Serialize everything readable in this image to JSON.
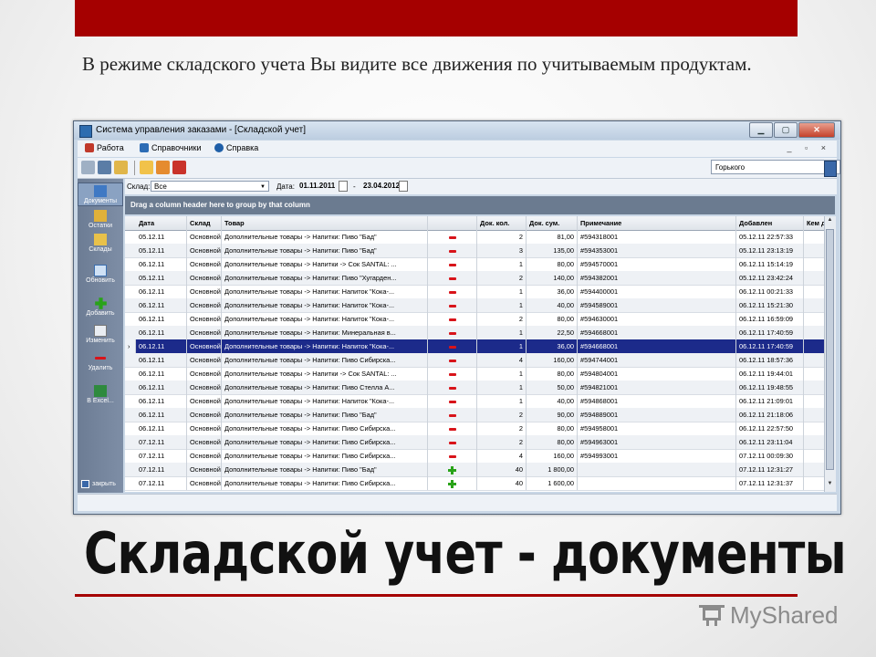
{
  "slide": {
    "subtitle": "В режиме складского учета Вы видите все движения по учитываемым продуктам.",
    "title": "Складской учет - документы",
    "brand": "MyShared"
  },
  "app": {
    "window_title": "Система управления заказами - [Складской учет]",
    "window_buttons": [
      "▁",
      "▢",
      "✕"
    ],
    "menu": [
      {
        "label": "Работа",
        "icon": "work-icon"
      },
      {
        "label": "Справочники",
        "icon": "references-icon"
      },
      {
        "label": "Справка",
        "icon": "help-icon"
      }
    ],
    "mdi_controls": "_ ▫ ×",
    "style_select": "Горького",
    "filter": {
      "warehouse_label": "Склад:",
      "warehouse_value": "Все",
      "date_label": "Дата:",
      "date_from": "01.11.2011",
      "date_sep": "-",
      "date_to": "23.04.2012"
    },
    "group_hint": "Drag a column header here to group by that column",
    "sidebar": [
      {
        "label": "Документы",
        "icon": "documents-icon",
        "active": true
      },
      {
        "label": "Остатки",
        "icon": "balance-icon"
      },
      {
        "label": "Склады",
        "icon": "warehouses-icon"
      },
      {
        "label": "Обновить",
        "icon": "refresh-icon"
      },
      {
        "label": "Добавить",
        "icon": "add-icon"
      },
      {
        "label": "Изменить",
        "icon": "edit-icon"
      },
      {
        "label": "Удалить",
        "icon": "delete-icon"
      },
      {
        "label": "В Excel...",
        "icon": "excel-icon"
      },
      {
        "label": "закрыть",
        "icon": "close-panel-icon"
      }
    ],
    "columns": [
      "Дата",
      "Склад",
      "Товар",
      "",
      "Док. кол.",
      "Док. сум.",
      "Примечание",
      "Добавлен",
      "Кем добавлен"
    ],
    "rows": [
      {
        "date": "05.12.11",
        "store": "Основной",
        "item": "Дополнительные товары -> Напитки: Пиво \"Бад\"",
        "op": "minus",
        "qty": "2",
        "sum": "81,00",
        "note": "#594318001",
        "added": "05.12.11 22:57:33",
        "by": ""
      },
      {
        "date": "05.12.11",
        "store": "Основной",
        "item": "Дополнительные товары -> Напитки: Пиво \"Бад\"",
        "op": "minus",
        "qty": "3",
        "sum": "135,00",
        "note": "#594353001",
        "added": "05.12.11 23:13:19",
        "by": ""
      },
      {
        "date": "06.12.11",
        "store": "Основной",
        "item": "Дополнительные товары -> Напитки -> Сок SANTAL: ...",
        "op": "minus",
        "qty": "1",
        "sum": "80,00",
        "note": "#594570001",
        "added": "06.12.11 15:14:19",
        "by": ""
      },
      {
        "date": "05.12.11",
        "store": "Основной",
        "item": "Дополнительные товары -> Напитки: Пиво \"Хугарден...",
        "op": "minus",
        "qty": "2",
        "sum": "140,00",
        "note": "#594382001",
        "added": "05.12.11 23:42:24",
        "by": ""
      },
      {
        "date": "06.12.11",
        "store": "Основной",
        "item": "Дополнительные товары -> Напитки: Напиток \"Кока-...",
        "op": "minus",
        "qty": "1",
        "sum": "36,00",
        "note": "#594400001",
        "added": "06.12.11 00:21:33",
        "by": ""
      },
      {
        "date": "06.12.11",
        "store": "Основной",
        "item": "Дополнительные товары -> Напитки: Напиток \"Кока-...",
        "op": "minus",
        "qty": "1",
        "sum": "40,00",
        "note": "#594589001",
        "added": "06.12.11 15:21:30",
        "by": ""
      },
      {
        "date": "06.12.11",
        "store": "Основной",
        "item": "Дополнительные товары -> Напитки: Напиток \"Кока-...",
        "op": "minus",
        "qty": "2",
        "sum": "80,00",
        "note": "#594630001",
        "added": "06.12.11 16:59:09",
        "by": ""
      },
      {
        "date": "06.12.11",
        "store": "Основной",
        "item": "Дополнительные товары -> Напитки: Минеральная в...",
        "op": "minus",
        "qty": "1",
        "sum": "22,50",
        "note": "#594668001",
        "added": "06.12.11 17:40:59",
        "by": ""
      },
      {
        "date": "06.12.11",
        "store": "Основной",
        "item": "Дополнительные товары -> Напитки: Напиток \"Кока-...",
        "op": "minus",
        "qty": "1",
        "sum": "36,00",
        "note": "#594668001",
        "added": "06.12.11 17:40:59",
        "by": "",
        "selected": true
      },
      {
        "date": "06.12.11",
        "store": "Основной",
        "item": "Дополнительные товары -> Напитки: Пиво Сибирска...",
        "op": "minus",
        "qty": "4",
        "sum": "160,00",
        "note": "#594744001",
        "added": "06.12.11 18:57:36",
        "by": ""
      },
      {
        "date": "06.12.11",
        "store": "Основной",
        "item": "Дополнительные товары -> Напитки -> Сок SANTAL: ...",
        "op": "minus",
        "qty": "1",
        "sum": "80,00",
        "note": "#594804001",
        "added": "06.12.11 19:44:01",
        "by": ""
      },
      {
        "date": "06.12.11",
        "store": "Основной",
        "item": "Дополнительные товары -> Напитки: Пиво Стелла А...",
        "op": "minus",
        "qty": "1",
        "sum": "50,00",
        "note": "#594821001",
        "added": "06.12.11 19:48:55",
        "by": ""
      },
      {
        "date": "06.12.11",
        "store": "Основной",
        "item": "Дополнительные товары -> Напитки: Напиток \"Кока-...",
        "op": "minus",
        "qty": "1",
        "sum": "40,00",
        "note": "#594868001",
        "added": "06.12.11 21:09:01",
        "by": ""
      },
      {
        "date": "06.12.11",
        "store": "Основной",
        "item": "Дополнительные товары -> Напитки: Пиво \"Бад\"",
        "op": "minus",
        "qty": "2",
        "sum": "90,00",
        "note": "#594889001",
        "added": "06.12.11 21:18:06",
        "by": ""
      },
      {
        "date": "06.12.11",
        "store": "Основной",
        "item": "Дополнительные товары -> Напитки: Пиво Сибирска...",
        "op": "minus",
        "qty": "2",
        "sum": "80,00",
        "note": "#594958001",
        "added": "06.12.11 22:57:50",
        "by": ""
      },
      {
        "date": "07.12.11",
        "store": "Основной",
        "item": "Дополнительные товары -> Напитки: Пиво Сибирска...",
        "op": "minus",
        "qty": "2",
        "sum": "80,00",
        "note": "#594963001",
        "added": "06.12.11 23:11:04",
        "by": ""
      },
      {
        "date": "07.12.11",
        "store": "Основной",
        "item": "Дополнительные товары -> Напитки: Пиво Сибирска...",
        "op": "minus",
        "qty": "4",
        "sum": "160,00",
        "note": "#594993001",
        "added": "07.12.11 00:09:30",
        "by": ""
      },
      {
        "date": "07.12.11",
        "store": "Основной",
        "item": "Дополнительные товары -> Напитки: Пиво \"Бад\"",
        "op": "plus",
        "qty": "40",
        "sum": "1 800,00",
        "note": "",
        "added": "07.12.11 12:31:27",
        "by": ""
      },
      {
        "date": "07.12.11",
        "store": "Основной",
        "item": "Дополнительные товары -> Напитки: Пиво Сибирска...",
        "op": "plus",
        "qty": "40",
        "sum": "1 600,00",
        "note": "",
        "added": "07.12.11 12:31:37",
        "by": ""
      }
    ],
    "selected_marker": "›",
    "colors": {
      "accent_red": "#a50000",
      "selection": "#1c2a8a",
      "minus": "#d8141a",
      "plus": "#29a319"
    }
  }
}
